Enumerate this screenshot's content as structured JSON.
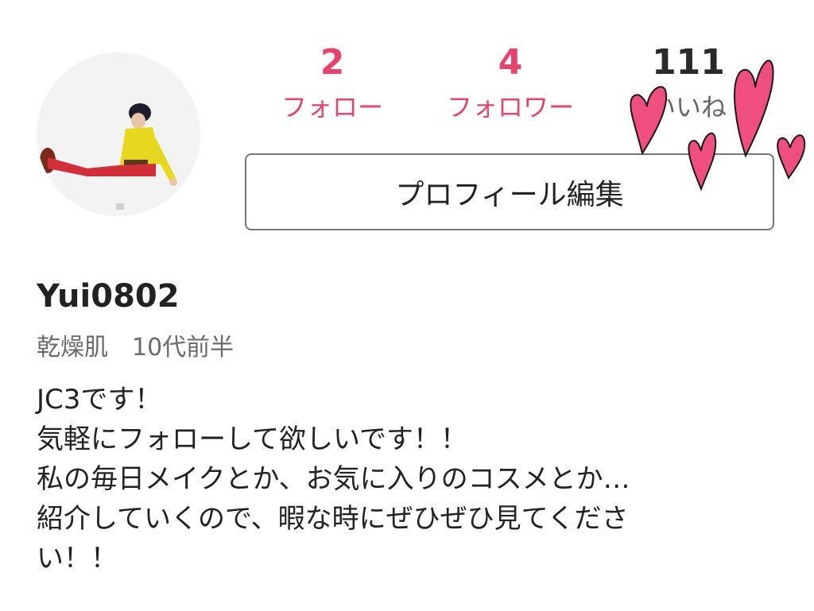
{
  "profile": {
    "following_count": "2",
    "following_label": "フォロー",
    "followers_count": "4",
    "followers_label": "フォロワー",
    "likes_count": "111",
    "likes_label": "いいね",
    "edit_button_label": "プロフィール編集",
    "username": "Yui0802",
    "skin_info": "乾燥肌　10代前半",
    "bio_lines": [
      "JC3です！",
      "気軽にフォローして欲しいです！！",
      "私の毎日メイクとか、お気に入りのコスメとか…",
      "紹介していくので、暇な時にぜひぜひ見てくださ",
      "い！！"
    ]
  },
  "colors": {
    "accent_pink": "#e8436d",
    "heart_pink": "#ee4f7e"
  }
}
